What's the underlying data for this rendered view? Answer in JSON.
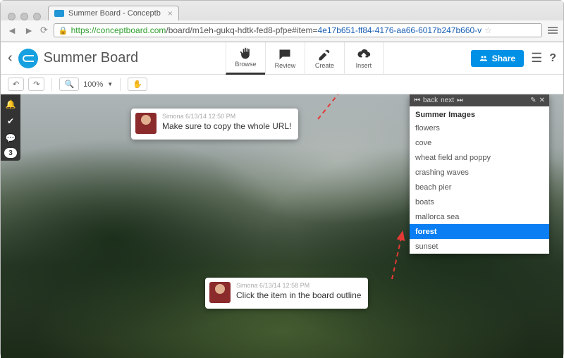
{
  "browser": {
    "tab_title": "Summer Board - Conceptb",
    "url_scheme": "https://",
    "url_host": "conceptboard.com",
    "url_path": "/board/m1eh-gukq-hdtk-fed8-pfpe",
    "url_hash_prefix": "#item=",
    "url_hash_highlight": "4e17b651-ff84-4176-aa66-6017b247b660-v"
  },
  "header": {
    "board_title": "Summer Board",
    "tools": [
      {
        "label": "Browse",
        "active": true
      },
      {
        "label": "Review",
        "active": false
      },
      {
        "label": "Create",
        "active": false
      },
      {
        "label": "Insert",
        "active": false
      }
    ],
    "share_label": "Share"
  },
  "zoombar": {
    "zoom_level": "100%"
  },
  "sidebar_badge": "3",
  "comments": [
    {
      "author": "Simona",
      "timestamp": "6/13/14 12:50 PM",
      "text": "Make sure to copy the whole URL!"
    },
    {
      "author": "Simona",
      "timestamp": "6/13/14 12:58 PM",
      "text": "Click the item in the board outline"
    }
  ],
  "outline": {
    "back_label": "back",
    "next_label": "next",
    "title": "Summer Images",
    "items": [
      {
        "label": "flowers",
        "selected": false
      },
      {
        "label": "cove",
        "selected": false
      },
      {
        "label": "wheat field and poppy",
        "selected": false
      },
      {
        "label": "crashing waves",
        "selected": false
      },
      {
        "label": "beach pier",
        "selected": false
      },
      {
        "label": "boats",
        "selected": false
      },
      {
        "label": "mallorca sea",
        "selected": false
      },
      {
        "label": "forest",
        "selected": true
      },
      {
        "label": "sunset",
        "selected": false
      }
    ]
  }
}
